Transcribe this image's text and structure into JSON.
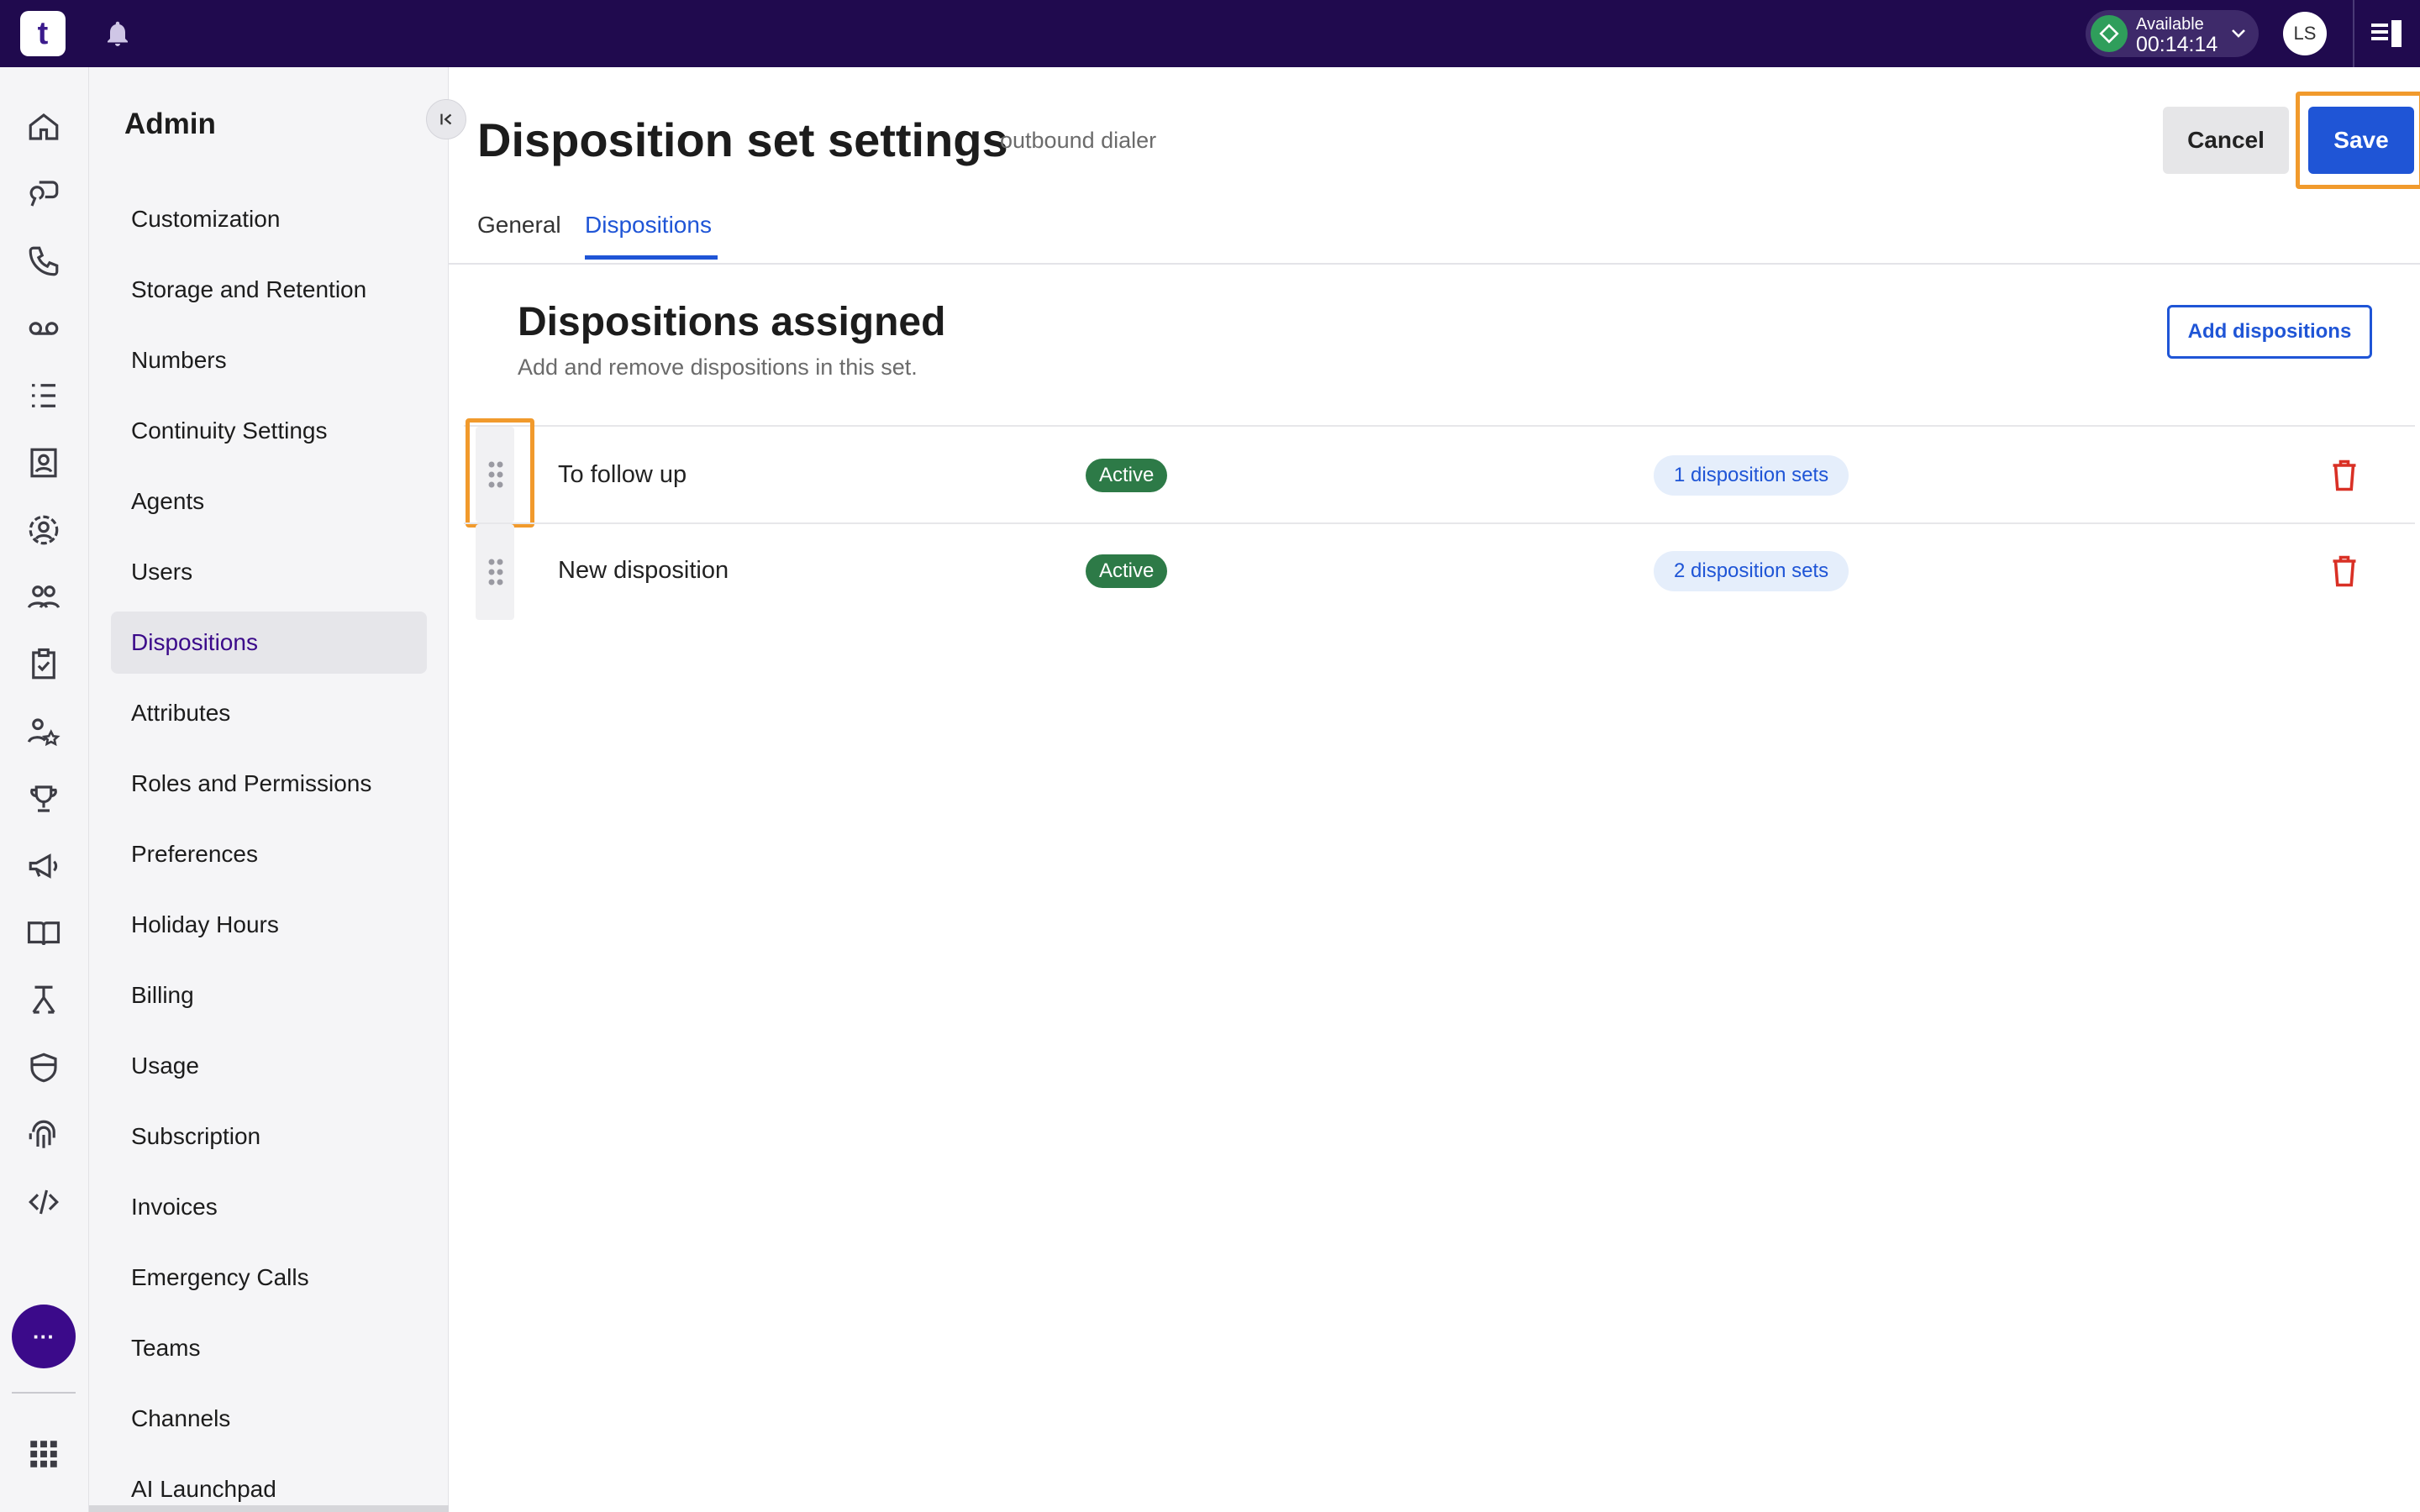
{
  "topbar": {
    "logo_text": "t",
    "status": {
      "label": "Available",
      "time": "00:14:14",
      "color": "#2f9e5b"
    },
    "avatar_initials": "LS"
  },
  "rail": {
    "icons": [
      "home-icon",
      "conversations-icon",
      "phone-icon",
      "voicemail-icon",
      "list-icon",
      "contacts-icon",
      "agent-icon",
      "team-icon",
      "clipboard-icon",
      "people-star-icon",
      "trophy-icon",
      "megaphone-icon",
      "book-icon",
      "workflow-icon",
      "shield-icon",
      "fingerprint-icon",
      "code-icon"
    ],
    "more_label": "···",
    "apps_icon": "grid-icon"
  },
  "sidebar": {
    "title": "Admin",
    "items": [
      {
        "label": "Customization"
      },
      {
        "label": "Storage and Retention"
      },
      {
        "label": "Numbers"
      },
      {
        "label": "Continuity Settings"
      },
      {
        "label": "Agents"
      },
      {
        "label": "Users"
      },
      {
        "label": "Dispositions"
      },
      {
        "label": "Attributes"
      },
      {
        "label": "Roles and Permissions"
      },
      {
        "label": "Preferences"
      },
      {
        "label": "Holiday Hours"
      },
      {
        "label": "Billing"
      },
      {
        "label": "Usage"
      },
      {
        "label": "Subscription"
      },
      {
        "label": "Invoices"
      },
      {
        "label": "Emergency Calls"
      },
      {
        "label": "Teams"
      },
      {
        "label": "Channels"
      },
      {
        "label": "AI Launchpad"
      }
    ],
    "active_item": "Dispositions"
  },
  "header": {
    "title": "Disposition set settings",
    "subtitle": "outbound dialer",
    "cancel_label": "Cancel",
    "save_label": "Save"
  },
  "tabs": [
    {
      "label": "General"
    },
    {
      "label": "Dispositions"
    }
  ],
  "active_tab": "Dispositions",
  "section": {
    "title": "Dispositions assigned",
    "description": "Add and remove dispositions in this set.",
    "add_label": "Add dispositions"
  },
  "dispositions": [
    {
      "name": "To follow up",
      "status": "Active",
      "sets": "1 disposition sets"
    },
    {
      "name": "New disposition",
      "status": "Active",
      "sets": "2 disposition sets"
    }
  ],
  "colors": {
    "brand_dark": "#200a4e",
    "primary": "#1f55d6",
    "active_badge": "#2d7a47",
    "highlight": "#f19a2c",
    "danger": "#d93025"
  }
}
